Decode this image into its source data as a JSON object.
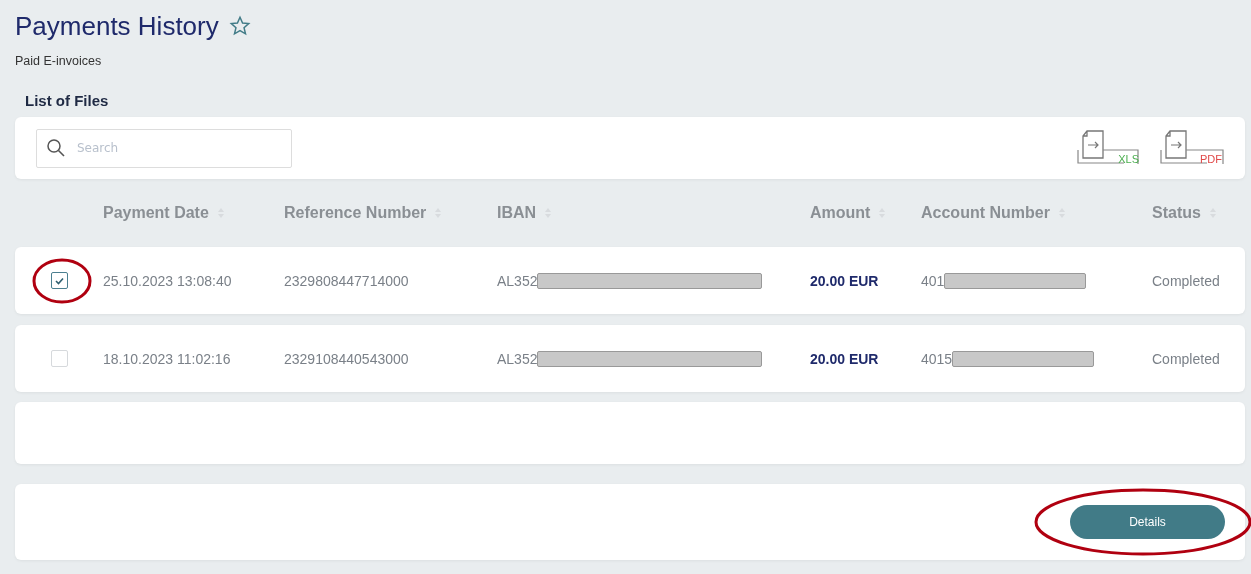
{
  "page": {
    "title": "Payments History",
    "favorite": false,
    "subtitle": "Paid E-invoices"
  },
  "section_title": "List of Files",
  "toolbar": {
    "search": {
      "placeholder": "Search"
    },
    "exports": [
      {
        "kind": "xls",
        "label": "XLS"
      },
      {
        "kind": "pdf",
        "label": "PDF"
      }
    ]
  },
  "table": {
    "columns": [
      "Payment Date",
      "Reference Number",
      "IBAN",
      "Amount",
      "Account Number",
      "Status"
    ],
    "rows": [
      {
        "checked": true,
        "highlighted": true,
        "date": "25.10.2023 13:08:40",
        "reference": "2329808447714000",
        "iban": "AL352",
        "amount": "20.00 EUR",
        "account": "401",
        "status": "Completed"
      },
      {
        "checked": false,
        "highlighted": false,
        "date": "18.10.2023 11:02:16",
        "reference": "2329108440543000",
        "iban": "AL352",
        "amount": "20.00 EUR",
        "account": "4015",
        "status": "Completed"
      }
    ]
  },
  "footer": {
    "button": {
      "label": "Details",
      "highlighted": true
    }
  }
}
